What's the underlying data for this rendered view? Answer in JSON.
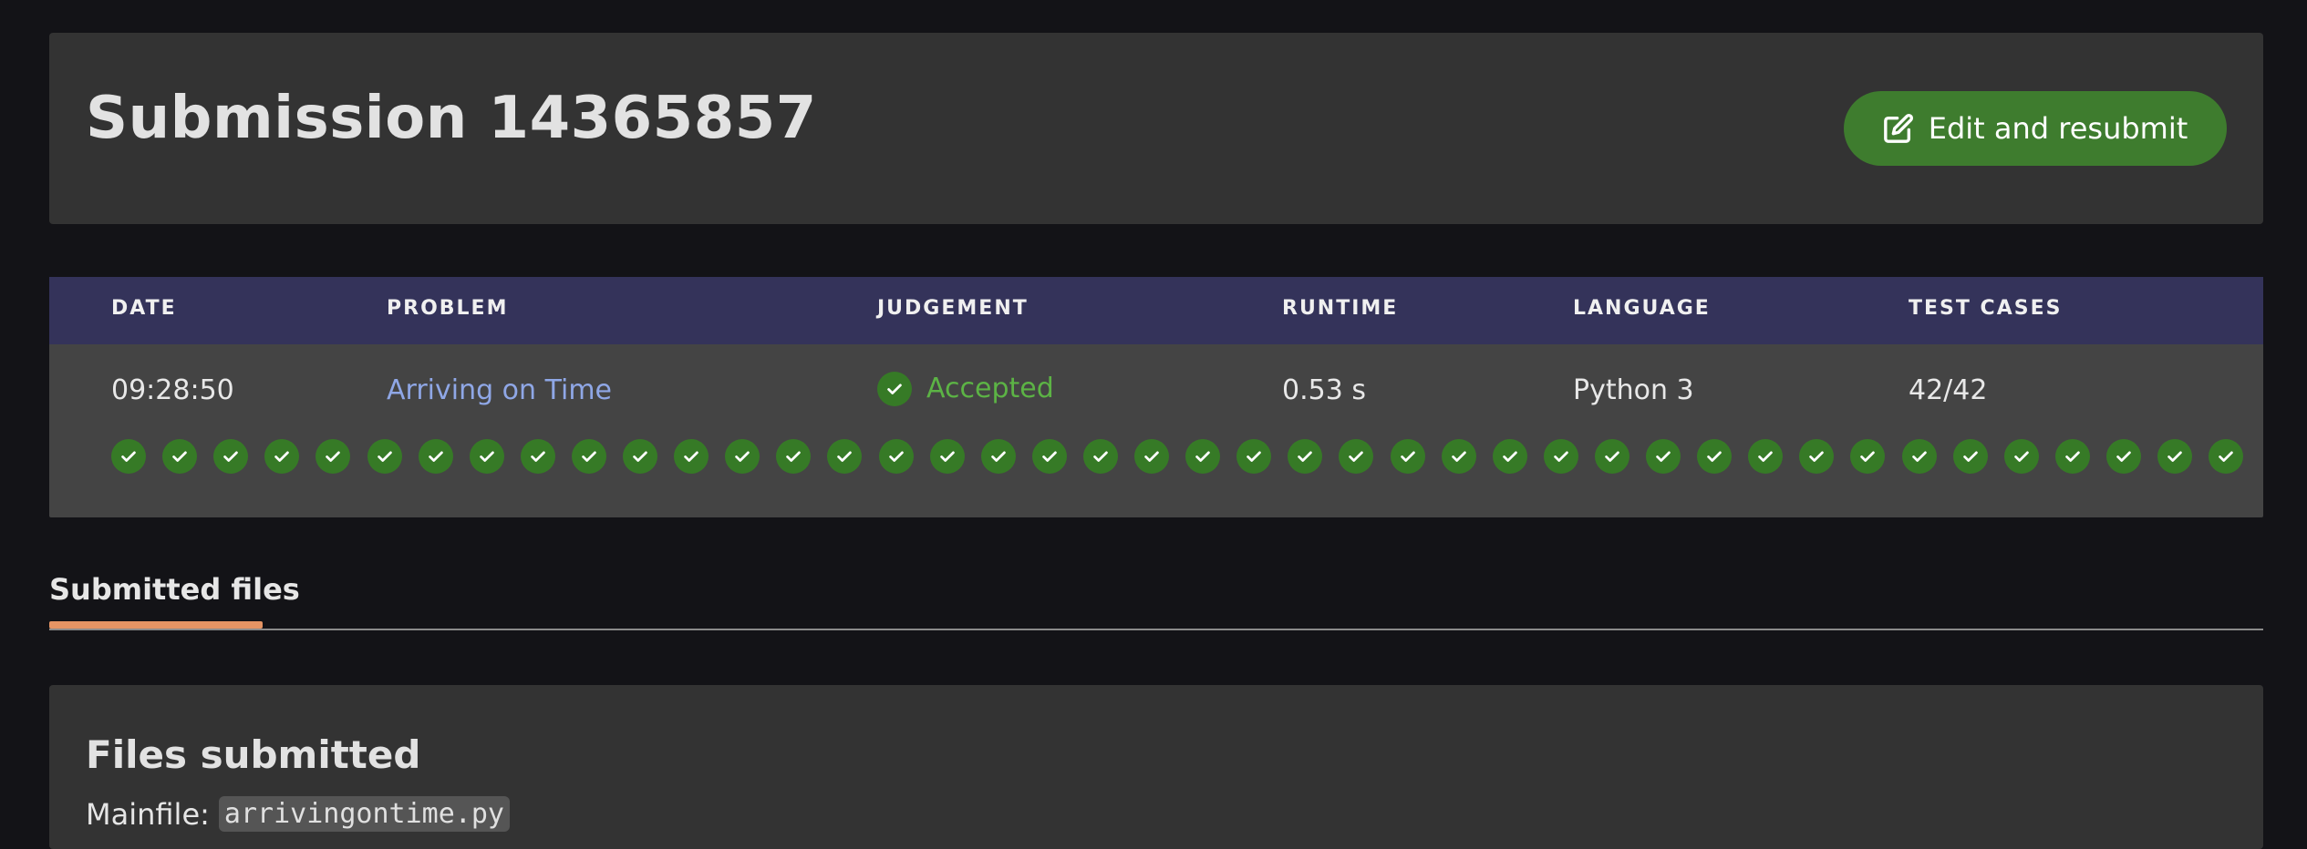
{
  "header": {
    "title": "Submission 14365857",
    "resubmit_label": "Edit and resubmit",
    "resubmit_icon": "edit-icon"
  },
  "table": {
    "columns": [
      "DATE",
      "PROBLEM",
      "JUDGEMENT",
      "RUNTIME",
      "LANGUAGE",
      "TEST CASES"
    ],
    "row": {
      "date": "09:28:50",
      "problem": "Arriving on Time",
      "judgement": "Accepted",
      "runtime": "0.53 s",
      "language": "Python 3",
      "test_cases": "42/42"
    },
    "test_case_count": 42,
    "test_case_status": "accepted"
  },
  "tabs": {
    "active": "Submitted files"
  },
  "files": {
    "title": "Files submitted",
    "mainfile_label": "Mainfile:",
    "mainfile_name": "arrivingontime.py"
  },
  "colors": {
    "accent_green": "#3e7c2e",
    "accepted_text": "#5cb345",
    "table_header": "#34335a",
    "tab_underline": "#e59464",
    "link": "#8fa7e6"
  }
}
